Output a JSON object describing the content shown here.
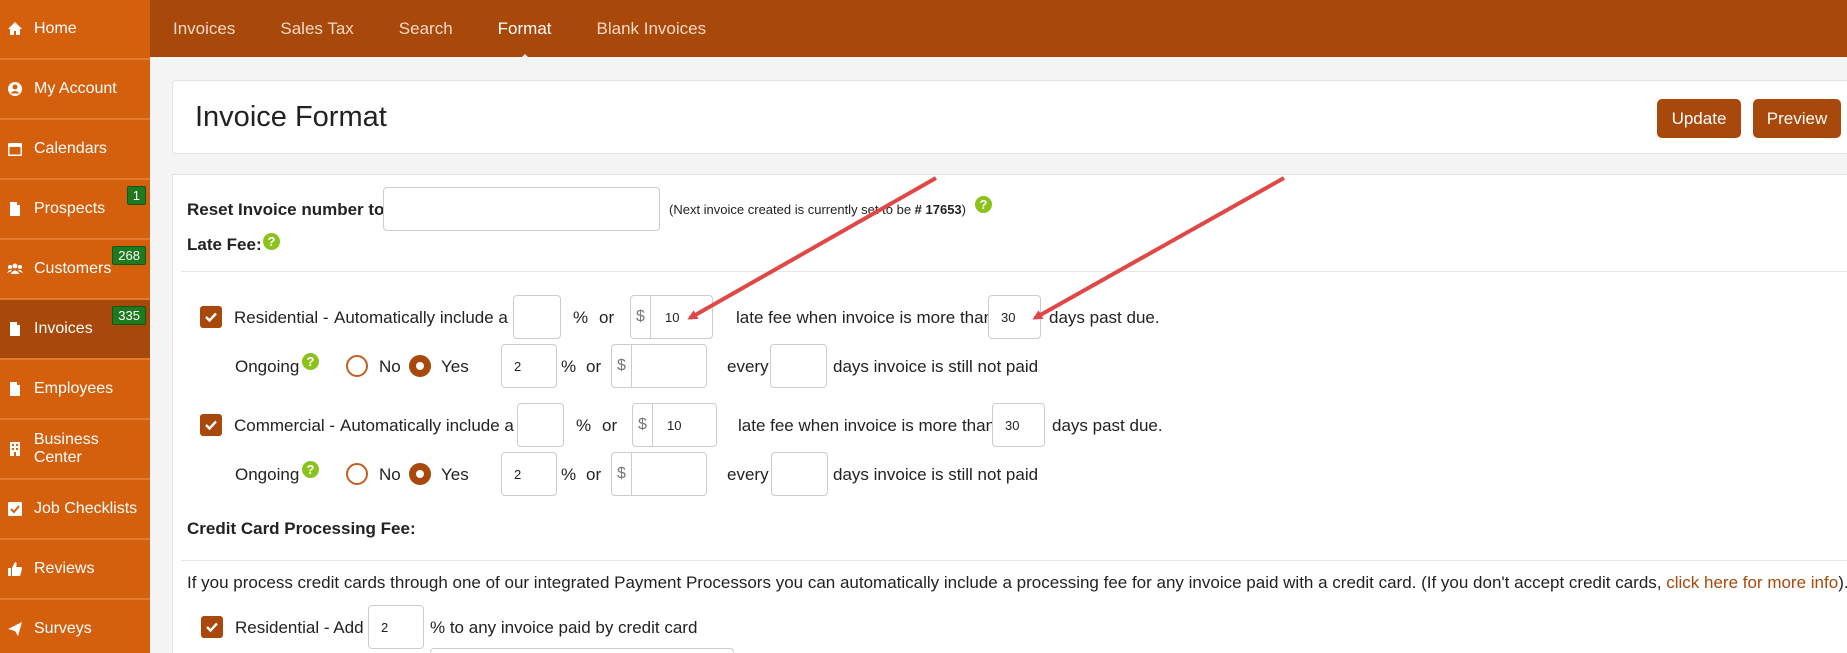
{
  "sidebar": {
    "items": [
      {
        "label": "Home",
        "icon": "home-icon"
      },
      {
        "label": "My Account",
        "icon": "user-circle-icon"
      },
      {
        "label": "Calendars",
        "icon": "calendar-icon"
      },
      {
        "label": "Prospects",
        "icon": "file-icon",
        "badge": "1"
      },
      {
        "label": "Customers",
        "icon": "users-icon",
        "badge": "268"
      },
      {
        "label": "Invoices",
        "icon": "file-icon",
        "badge": "335"
      },
      {
        "label": "Employees",
        "icon": "file-icon"
      },
      {
        "label": "Business Center",
        "icon": "building-icon"
      },
      {
        "label": "Job Checklists",
        "icon": "checkbox-icon"
      },
      {
        "label": "Reviews",
        "icon": "thumbs-up-icon"
      },
      {
        "label": "Surveys",
        "icon": "send-icon"
      }
    ]
  },
  "topnav": {
    "tabs": [
      "Invoices",
      "Sales Tax",
      "Search",
      "Format",
      "Blank Invoices"
    ],
    "active": "Format"
  },
  "header": {
    "title": "Invoice Format",
    "update_label": "Update",
    "preview_label": "Preview"
  },
  "reset": {
    "label": "Reset Invoice number to:",
    "value": "",
    "note_prefix": "(Next invoice created is currently set to be ",
    "note_number": "# 17653",
    "note_suffix": ")"
  },
  "late_fee": {
    "heading": "Late Fee:",
    "auto_text": "Automatically include a",
    "pct": "%",
    "or": "or",
    "dollar": "$",
    "when_text": "late fee when invoice is more than",
    "days_past": "days past due.",
    "ongoing_label": "Ongoing",
    "no_label": "No",
    "yes_label": "Yes",
    "every_label": "every",
    "still_text": "days invoice is still not paid",
    "residential": {
      "label": "Residential -",
      "checked": true,
      "percent": "",
      "amount": "10",
      "days": "30",
      "ongoing": "Yes",
      "ongoing_percent": "2",
      "ongoing_amount": "",
      "ongoing_days": ""
    },
    "commercial": {
      "label": "Commercial -",
      "checked": true,
      "percent": "",
      "amount": "10",
      "days": "30",
      "ongoing": "Yes",
      "ongoing_percent": "2",
      "ongoing_amount": "",
      "ongoing_days": ""
    }
  },
  "cc_fee": {
    "heading": "Credit Card Processing Fee:",
    "description": "If you process credit cards through one of our integrated Payment Processors you can automatically include a processing fee for any invoice paid with a credit card. (If you don't accept credit cards, ",
    "link_text": "click here for more info",
    "description_end": ").",
    "residential_label": "Residential - Add",
    "residential_value": "2",
    "residential_suffix": "% to any invoice paid by credit card"
  },
  "colors": {
    "sidebar": "#d4600e",
    "topnav": "#a8480a",
    "accent": "#a8480a",
    "badge": "#1f7a1f",
    "help": "#8cc21c",
    "arrow": "#e04848"
  }
}
